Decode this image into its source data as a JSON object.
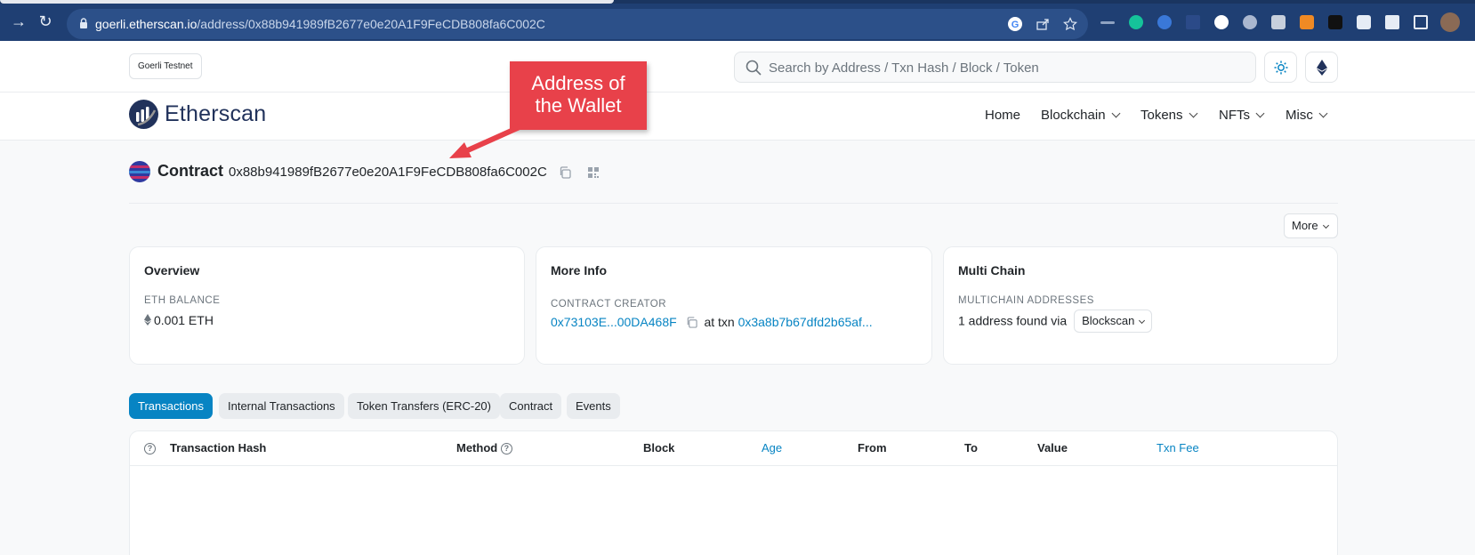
{
  "browser": {
    "url_host": "goerli.etherscan.io",
    "url_path": "/address/0x88b941989fB2677e0e20A1F9FeCDB808fa6C002C"
  },
  "topbar": {
    "network_badge": "Goerli Testnet",
    "search_placeholder": "Search by Address / Txn Hash / Block / Token"
  },
  "nav": {
    "brand": "Etherscan",
    "items": [
      "Home",
      "Blockchain",
      "Tokens",
      "NFTs",
      "Misc"
    ]
  },
  "header": {
    "label": "Contract",
    "address": "0x88b941989fB2677e0e20A1F9FeCDB808fa6C002C",
    "more_button": "More"
  },
  "cards": {
    "overview": {
      "title": "Overview",
      "caption": "ETH BALANCE",
      "value": "0.001 ETH"
    },
    "more_info": {
      "title": "More Info",
      "caption": "CONTRACT CREATOR",
      "creator": "0x73103E...00DA468F",
      "at_txn": "at txn",
      "txn": "0x3a8b7b67dfd2b65af..."
    },
    "multi_chain": {
      "title": "Multi Chain",
      "caption": "MULTICHAIN ADDRESSES",
      "found_text": "1 address found via",
      "dropdown": "Blockscan"
    }
  },
  "tabs": [
    "Transactions",
    "Internal Transactions",
    "Token Transfers (ERC-20)",
    "Contract",
    "Events"
  ],
  "table": {
    "headers": [
      "Transaction Hash",
      "Method",
      "Block",
      "Age",
      "From",
      "To",
      "Value",
      "Txn Fee"
    ]
  },
  "annotation": {
    "line1": "Address of",
    "line2": "the Wallet"
  },
  "colors": {
    "brand": "#21325b",
    "link": "#0784c3",
    "callout": "#e8414a",
    "chrome": "#1f3f73"
  }
}
